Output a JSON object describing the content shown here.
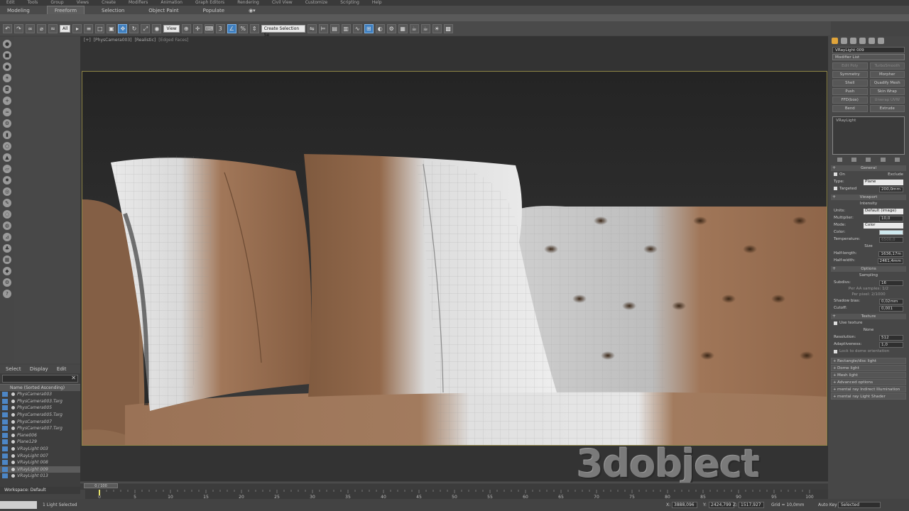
{
  "menubar": {
    "items": [
      "Edit",
      "Tools",
      "Group",
      "Views",
      "Create",
      "Modifiers",
      "Animation",
      "Graph Editors",
      "Rendering",
      "Civil View",
      "Customize",
      "Scripting",
      "Help"
    ]
  },
  "ribbon": {
    "tabs": [
      "Modeling",
      "Freeform",
      "Selection",
      "Object Paint",
      "Populate"
    ],
    "active": "Freeform"
  },
  "toolbar": {
    "filter_value": "All",
    "refcoord_value": "View",
    "selection_set_value": "Create Selection Se"
  },
  "scene_explorer": {
    "menu": [
      "Select",
      "Display",
      "Edit"
    ],
    "column_header": "Name (Sorted Ascending)",
    "rows": [
      "PhysCamera003",
      "PhysCamera003.Targ",
      "PhysCamera005",
      "PhysCamera005.Targ",
      "PhysCamera007",
      "PhysCamera007.Targ",
      "Plane006",
      "Plane129",
      "VRayLight 003",
      "VRayLight 007",
      "VRayLight 008",
      "VRayLight 009",
      "VRayLight 013"
    ],
    "selected_index": 11,
    "workspace_label": "Workspace: Default"
  },
  "viewport": {
    "label_parts": [
      "[+]",
      "[PhysCamera003]",
      "[Realistic]",
      "[Edged Faces]"
    ]
  },
  "watermark": "3dobject",
  "command_panel": {
    "object_name": "VRayLight 009",
    "modifier_list": "Modifier List",
    "modifier_buttons": [
      {
        "label": "Edit Poly",
        "dim": true
      },
      {
        "label": "TurboSmooth",
        "dim": true
      },
      {
        "label": "Symmetry",
        "dim": false
      },
      {
        "label": "Morpher",
        "dim": false
      },
      {
        "label": "Shell",
        "dim": false
      },
      {
        "label": "Quadify Mesh",
        "dim": false
      },
      {
        "label": "Push",
        "dim": false
      },
      {
        "label": "Skin Wrap",
        "dim": false
      },
      {
        "label": "FFD(box)",
        "dim": false
      },
      {
        "label": "Unwrap UVW",
        "dim": true
      },
      {
        "label": "Bend",
        "dim": false
      },
      {
        "label": "Extrude",
        "dim": false
      }
    ],
    "stack_item": "VRayLight",
    "general": {
      "header": "General",
      "on_label": "On",
      "exclude_label": "Exclude",
      "type_label": "Type:",
      "type_value": "Plane",
      "targeted_label": "Targeted",
      "targeted_value": "200,0mm"
    },
    "viewport_header": "Viewport",
    "intensity": {
      "header": "Intensity",
      "units_label": "Units:",
      "units_value": "Default (image)",
      "multiplier_label": "Multiplier:",
      "multiplier_value": "10,0",
      "mode_label": "Mode:",
      "mode_value": "Color",
      "color_label": "Color:",
      "color_swatch": "#cfe9ef",
      "temperature_label": "Temperature:",
      "temperature_value": "6500,0"
    },
    "size": {
      "header": "Size",
      "half_length_label": "Half-length:",
      "half_length_value": "1636,17m",
      "half_width_label": "Half-width:",
      "half_width_value": "2461,4mm"
    },
    "options_header": "Options",
    "sampling": {
      "header": "Sampling",
      "subdivs_label": "Subdivs:",
      "subdivs_value": "16",
      "aa_samples": "Per AA samples: 1/2",
      "per_pixel": "Per pixel: 2/1000",
      "shadow_bias_label": "Shadow bias:",
      "shadow_bias_value": "0,02mm",
      "cutoff_label": "Cutoff:",
      "cutoff_value": "0,001"
    },
    "texture": {
      "header": "Texture",
      "use_texture": "Use texture",
      "none_label": "None",
      "resolution_label": "Resolution:",
      "resolution_value": "512",
      "adaptiveness_label": "Adaptiveness:",
      "adaptiveness_value": "1,0",
      "lock_label": "Lock to dome orientation"
    },
    "rollouts": [
      "Rectangle/disc light",
      "Dome light",
      "Mesh light",
      "Advanced options",
      "mental ray Indirect Illumination",
      "mental ray Light Shader"
    ]
  },
  "timeline": {
    "slider": "0 / 100",
    "ticks": [
      0,
      5,
      10,
      15,
      20,
      25,
      30,
      35,
      40,
      45,
      50,
      55,
      60,
      65,
      70,
      75,
      80,
      85,
      90,
      95,
      100
    ]
  },
  "status": {
    "selection": "1 Light Selected",
    "x_label": "X:",
    "x_value": "3888,096",
    "y_label": "Y:",
    "y_value": "2424,799",
    "z_label": "Z:",
    "z_value": "1517,927",
    "grid": "Grid = 10,0mm",
    "autokey": "Auto Key",
    "key_mode": "Selected"
  }
}
